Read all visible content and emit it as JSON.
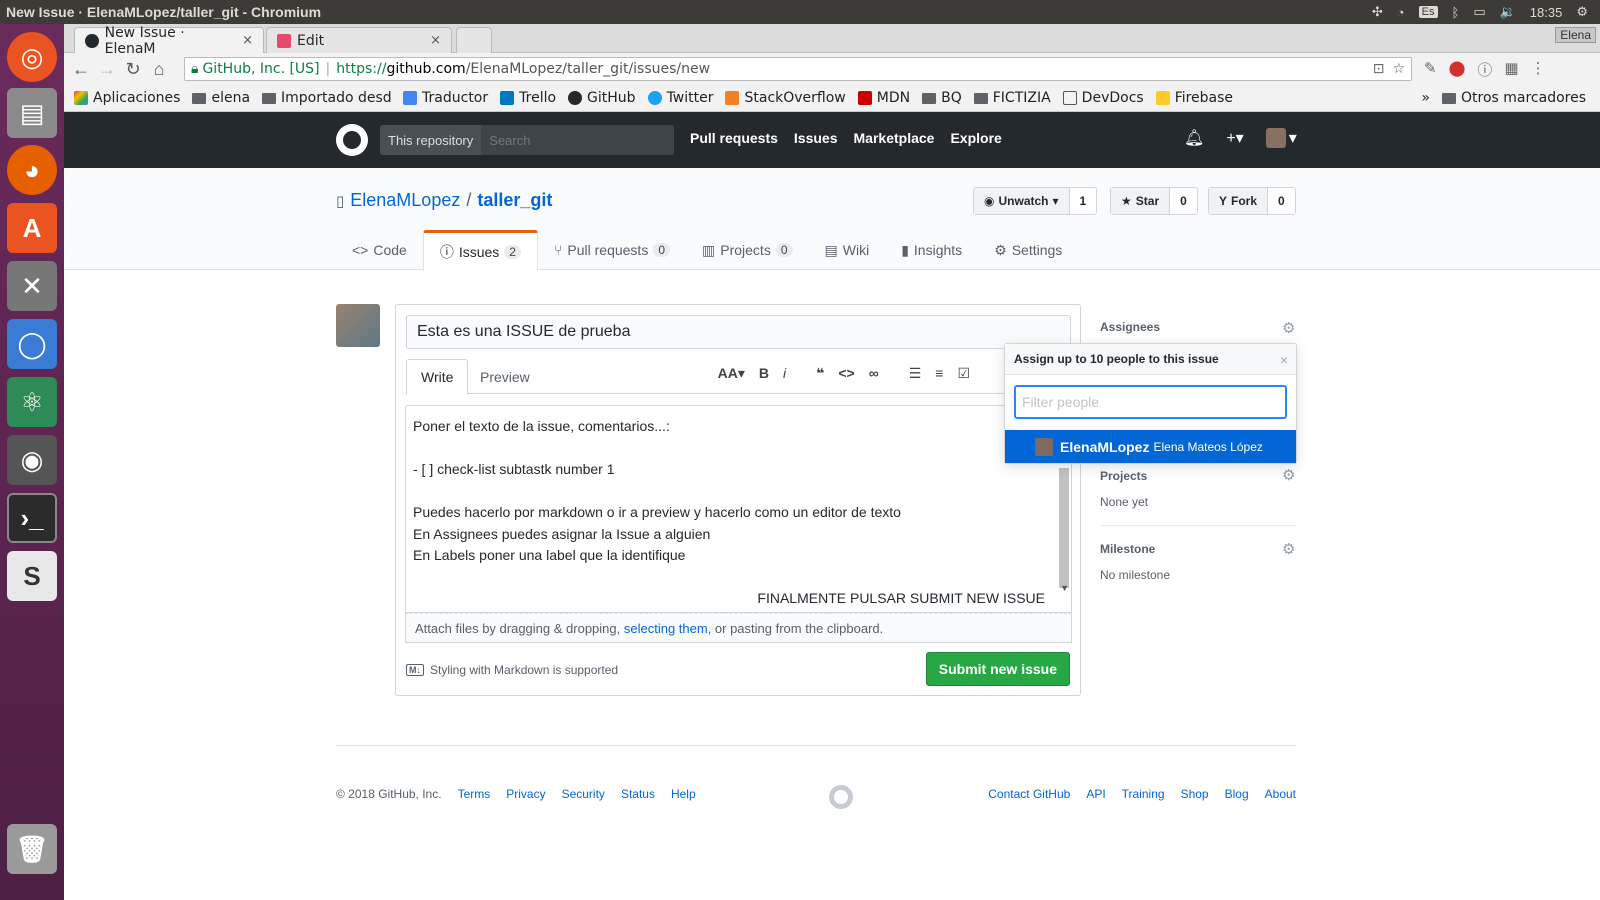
{
  "os": {
    "window_title": "New Issue · ElenaMLopez/taller_git - Chromium",
    "keyboard": "Es",
    "clock": "18:35"
  },
  "browser": {
    "tabs": [
      {
        "label": "New Issue · ElenaM",
        "close": "×"
      },
      {
        "label": "Edit",
        "close": "×"
      }
    ],
    "profile": "Elena",
    "security_label": "GitHub, Inc. [US]",
    "url_scheme": "https://",
    "url_host": "github.com",
    "url_path": "/ElenaMLopez/taller_git/issues/new",
    "bookmarks": [
      "Aplicaciones",
      "elena",
      "Importado desde",
      "Traductor",
      "Trello",
      "GitHub",
      "Twitter",
      "StackOverflow",
      "MDN",
      "BQ",
      "FICTIZIA",
      "DevDocs",
      "Firebase"
    ],
    "bookmarks_more": "»",
    "other_bookmarks": "Otros marcadores"
  },
  "github": {
    "scope": "This repository",
    "search_placeholder": "Search",
    "nav": [
      "Pull requests",
      "Issues",
      "Marketplace",
      "Explore"
    ]
  },
  "repo": {
    "owner": "ElenaMLopez",
    "slash": "/",
    "name": "taller_git",
    "watch_label": "Unwatch",
    "watch_count": "1",
    "star_label": "Star",
    "star_count": "0",
    "fork_label": "Fork",
    "fork_count": "0",
    "tabs": {
      "code": "Code",
      "issues": "Issues",
      "issues_count": "2",
      "pulls": "Pull requests",
      "pulls_count": "0",
      "projects": "Projects",
      "projects_count": "0",
      "wiki": "Wiki",
      "insights": "Insights",
      "settings": "Settings"
    }
  },
  "issue": {
    "title_value": "Esta es una ISSUE de prueba",
    "write_tab": "Write",
    "preview_tab": "Preview",
    "body_lines": [
      "Poner el texto de la issue, comentarios...:",
      "- [ ] check-list subtastk number 1",
      "Puedes hacerlo por markdown o ir a preview y hacerlo como un editor de texto",
      "En Assignees puedes asignar la Issue a alguien",
      "En Labels poner una label que la identifique",
      "FINALMENTE PULSAR SUBMIT NEW ISSUE"
    ],
    "attach_before": "Attach files by dragging & dropping, ",
    "attach_link": "selecting them",
    "attach_after": ", or pasting from the clipboard.",
    "markdown_note": "Styling with Markdown is supported",
    "submit_label": "Submit new issue"
  },
  "sidebar": {
    "assignees": "Assignees",
    "projects": "Projects",
    "projects_value": "None yet",
    "milestone": "Milestone",
    "milestone_value": "No milestone"
  },
  "popover": {
    "header": "Assign up to 10 people to this issue",
    "filter_placeholder": "Filter people",
    "login": "ElenaMLopez",
    "full_name": "Elena Mateos López"
  },
  "footer": {
    "copyright": "© 2018 GitHub, Inc.",
    "left_links": [
      "Terms",
      "Privacy",
      "Security",
      "Status",
      "Help"
    ],
    "right_links": [
      "Contact GitHub",
      "API",
      "Training",
      "Shop",
      "Blog",
      "About"
    ]
  },
  "colors": {
    "accent": "#0366d6",
    "submit": "#28a745",
    "issues_tab": "#e36209",
    "header": "#24292e"
  }
}
